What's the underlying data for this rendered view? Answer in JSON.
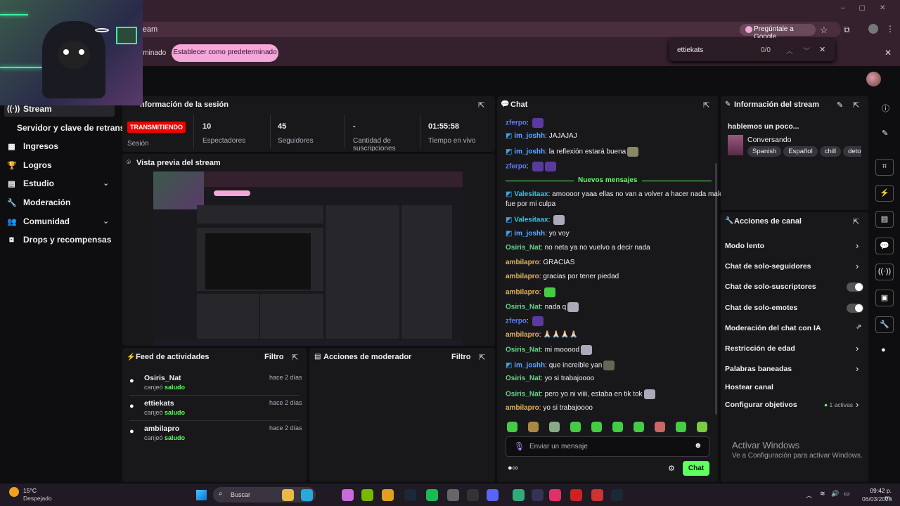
{
  "browser": {
    "url_partial": "tream",
    "ask_google": "Pregúntale a Google",
    "infobar_text": "rminado",
    "set_default": "Establecer como predeterminado",
    "find_query": "ettiekats",
    "find_count": "0/0"
  },
  "sidebar": {
    "items": [
      {
        "label": "Stream",
        "icon": "stream-icon"
      },
      {
        "label": "Servidor y clave de retransm",
        "icon": ""
      },
      {
        "label": "Ingresos",
        "icon": "revenue-icon"
      },
      {
        "label": "Logros",
        "icon": "trophy-icon"
      },
      {
        "label": "Estudio",
        "icon": "studio-icon"
      },
      {
        "label": "Moderación",
        "icon": "wrench-icon"
      },
      {
        "label": "Comunidad",
        "icon": "community-icon"
      },
      {
        "label": "Drops y recompensas",
        "icon": "drops-icon"
      }
    ]
  },
  "session": {
    "title": "nformación de la sesión",
    "live": "TRANSMITIENDO",
    "live_label": "Sesión",
    "stats": [
      {
        "value": "10",
        "label": "Espectadores"
      },
      {
        "value": "45",
        "label": "Seguidores"
      },
      {
        "value": "-",
        "label": "Cantidad de suscripciones"
      },
      {
        "value": "01:55:58",
        "label": "Tiempo en vivo"
      }
    ]
  },
  "preview": {
    "title": "Vista previa del stream"
  },
  "feed": {
    "title": "Feed de actividades",
    "filter": "Filtro",
    "items": [
      {
        "user": "Osiris_Nat",
        "action": "canjeó",
        "reward": "saludo",
        "time": "hace 2 días"
      },
      {
        "user": "ettiekats",
        "action": "canjeó",
        "reward": "saludo",
        "time": "hace 2 días"
      },
      {
        "user": "ambilapro",
        "action": "canjeó",
        "reward": "saludo",
        "time": "hace 2 días"
      }
    ]
  },
  "modactions": {
    "title": "Acciones de moderador",
    "filter": "Filtro"
  },
  "chat": {
    "title": "Chat",
    "new_messages": "Nuevos mensajes",
    "input_placeholder": "Enviar un mensaje",
    "send": "Chat",
    "messages": [
      {
        "user": "zferpo",
        "text": "",
        "color": "#5b7bff"
      },
      {
        "user": "im_joshh",
        "text": "JAJAJAJ",
        "color": "#5ea8ff"
      },
      {
        "user": "im_joshh",
        "text": "la reflexión estará buena",
        "color": "#5ea8ff"
      },
      {
        "user": "zferpo",
        "text": "",
        "color": "#5b7bff"
      },
      {
        "user": "Valesitaax",
        "text": "amoooor yaaa ellas no van a volver a hacer nada malo",
        "text2": "fue por mi culpa",
        "color": "#3ec1e0"
      },
      {
        "user": "Valesitaax",
        "text": "",
        "color": "#3ec1e0"
      },
      {
        "user": "im_joshh",
        "text": "yo voy",
        "color": "#5ea8ff"
      },
      {
        "user": "Osiris_Nat",
        "text": "no neta ya no vuelvo a decir nada",
        "color": "#67d48a"
      },
      {
        "user": "ambilapro",
        "text": "GRACIAS",
        "color": "#e6b35a"
      },
      {
        "user": "ambilapro",
        "text": "gracias por tener piedad",
        "color": "#e6b35a"
      },
      {
        "user": "ambilapro",
        "text": "",
        "color": "#e6b35a"
      },
      {
        "user": "Osiris_Nat",
        "text": "nada q",
        "color": "#67d48a"
      },
      {
        "user": "zferpo",
        "text": "",
        "color": "#5b7bff"
      },
      {
        "user": "ambilapro",
        "text": "🙏🏻🙏🏻🙏🏻🙏🏻",
        "color": "#e6b35a"
      },
      {
        "user": "Osiris_Nat",
        "text": "mi mooood",
        "color": "#67d48a"
      },
      {
        "user": "im_joshh",
        "text": "que increible yan",
        "color": "#5ea8ff"
      },
      {
        "user": "Osiris_Nat",
        "text": "yo si trabajoooo",
        "color": "#67d48a"
      },
      {
        "user": "Osiris_Nat",
        "text": "pero yo ni viiii, estaba en tik tok",
        "color": "#67d48a"
      },
      {
        "user": "ambilapro",
        "text": "yo si trabajoooo",
        "color": "#e6b35a"
      }
    ]
  },
  "streaminfo": {
    "title": "Información del stream",
    "stream_title": "hablemos un poco...",
    "category": "Conversando",
    "tags": [
      "Spanish",
      "Español",
      "chill",
      "deto"
    ]
  },
  "channelactions": {
    "title": "Acciones de canal",
    "items": [
      {
        "label": "Modo lento",
        "control": "chevron"
      },
      {
        "label": "Chat de solo-seguidores",
        "control": "chevron"
      },
      {
        "label": "Chat de solo-suscriptores",
        "control": "toggle"
      },
      {
        "label": "Chat de solo-emotes",
        "control": "toggle"
      },
      {
        "label": "Moderación del chat con IA",
        "control": "external"
      },
      {
        "label": "Restricción de edad",
        "control": "chevron"
      },
      {
        "label": "Palabras baneadas",
        "control": "chevron"
      },
      {
        "label": "Hostear canal",
        "control": "none"
      },
      {
        "label": "Configurar objetivos",
        "control": "chevron",
        "badge": "1 activas"
      }
    ]
  },
  "watermark": {
    "line1": "Activar Windows",
    "line2": "Ve a Configuración para activar Windows."
  },
  "taskbar": {
    "temp": "15°C",
    "weather": "Despejado",
    "search": "Buscar",
    "time": "09:42 p. m.",
    "date": "06/03/2026"
  },
  "colors": {
    "accent": "#5eff5e",
    "live": "#eb0400",
    "panel": "#18181b",
    "bg": "#0e0e10"
  }
}
